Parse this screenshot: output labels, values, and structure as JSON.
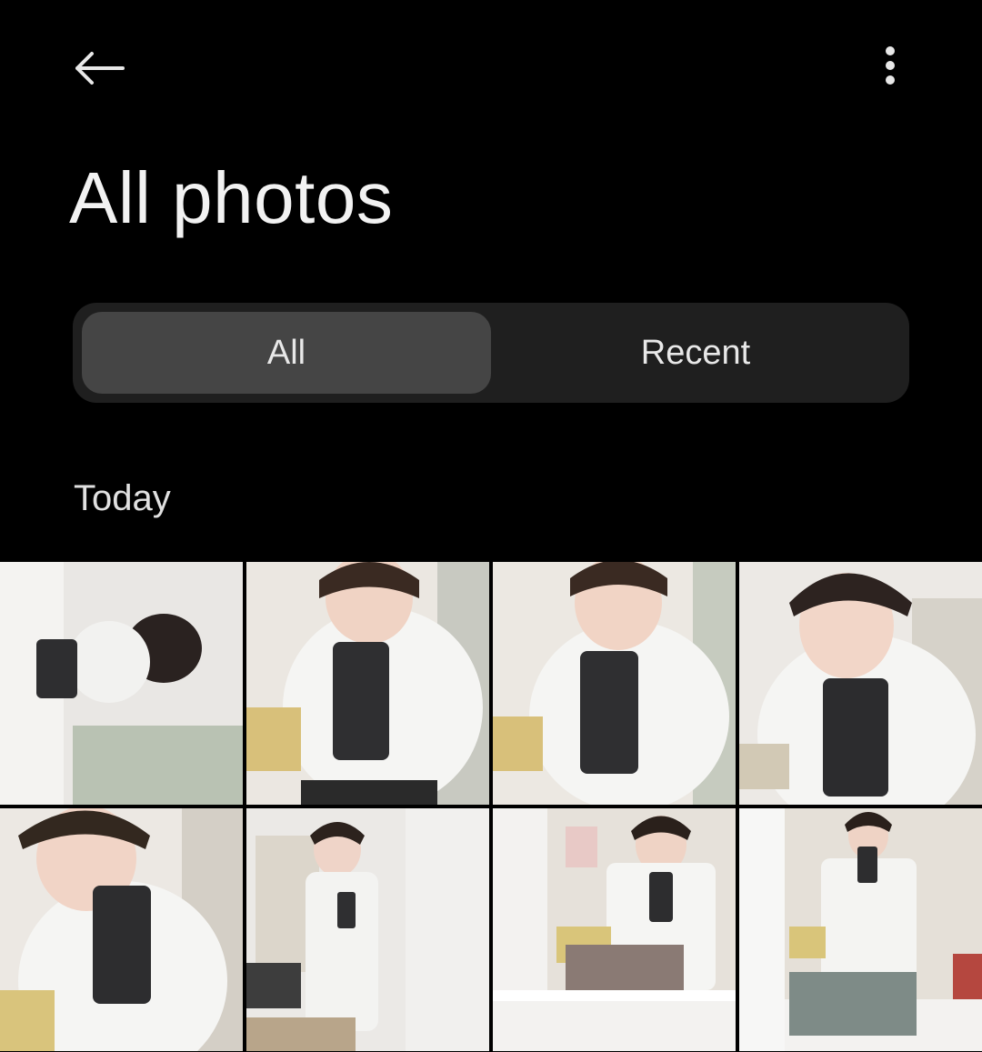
{
  "header": {
    "title": "All photos",
    "back_icon": "arrow-left-icon",
    "menu_icon": "more-vertical-icon"
  },
  "tabs": [
    {
      "label": "All",
      "selected": true
    },
    {
      "label": "Recent",
      "selected": false
    }
  ],
  "section": {
    "label": "Today"
  },
  "photos": [
    {
      "name": "photo-1",
      "description": "selfie"
    },
    {
      "name": "photo-2",
      "description": "selfie"
    },
    {
      "name": "photo-3",
      "description": "selfie"
    },
    {
      "name": "photo-4",
      "description": "selfie"
    },
    {
      "name": "photo-5",
      "description": "selfie"
    },
    {
      "name": "photo-6",
      "description": "selfie"
    },
    {
      "name": "photo-7",
      "description": "selfie"
    },
    {
      "name": "photo-8",
      "description": "selfie"
    }
  ],
  "colors": {
    "background": "#000000",
    "segment_track": "#1f1f1f",
    "segment_selected": "#454545",
    "text": "#f2f2f2"
  }
}
